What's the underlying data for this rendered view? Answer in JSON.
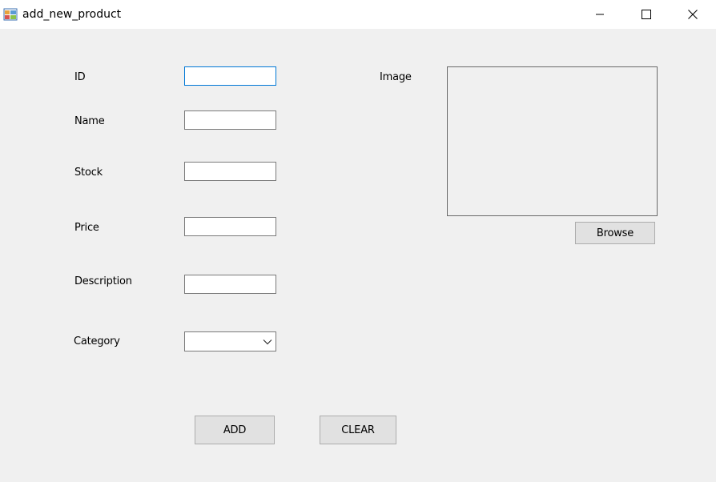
{
  "window": {
    "title": "add_new_product"
  },
  "form": {
    "labels": {
      "id": "ID",
      "name": "Name",
      "stock": "Stock",
      "price": "Price",
      "description": "Description",
      "category": "Category",
      "image": "Image"
    },
    "values": {
      "id": "",
      "name": "",
      "stock": "",
      "price": "",
      "description": "",
      "category": ""
    }
  },
  "buttons": {
    "browse": "Browse",
    "add": "ADD",
    "clear": "CLEAR"
  },
  "icons": {
    "app": "app-window-icon",
    "minimize": "minimize-icon",
    "maximize": "maximize-icon",
    "close": "close-icon",
    "dropdown": "chevron-down-icon"
  },
  "colors": {
    "focus_border": "#0078d7",
    "button_face": "#e1e1e1",
    "form_background": "#f0f0f0"
  }
}
